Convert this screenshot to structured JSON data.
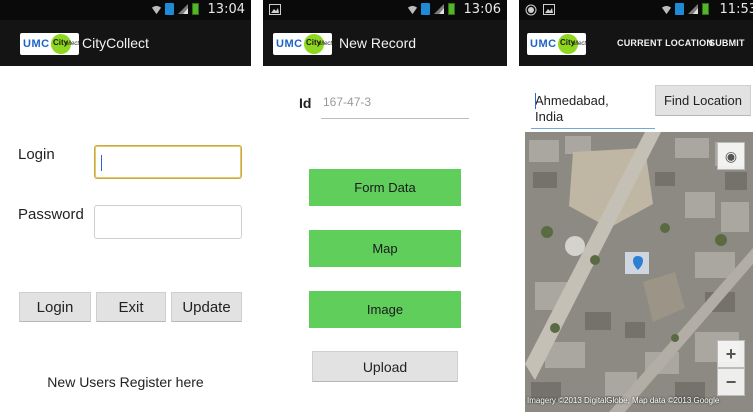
{
  "screens": {
    "login": {
      "status_time": "13:04",
      "logo_text": "UMC",
      "logo_circle_text": "City",
      "logo_subtext": "ollect",
      "app_title": "CityCollect",
      "login_label": "Login",
      "login_value": "",
      "password_label": "Password",
      "password_value": "",
      "buttons": [
        "Login",
        "Exit",
        "Update"
      ],
      "register_link": "New Users Register here"
    },
    "new_record": {
      "status_time": "13:06",
      "app_title": "New Record",
      "id_label": "Id",
      "id_value": "167-47-3",
      "buttons": [
        "Form Data",
        "Map",
        "Image"
      ],
      "upload_label": "Upload"
    },
    "map": {
      "status_time": "11:53",
      "actions": [
        "CURRENT LOCATION",
        "SUBMIT"
      ],
      "location_text": "Ahmedabad, India",
      "find_button": "Find Location",
      "zoom_in": "+",
      "zoom_out": "−",
      "attribution": "Imagery ©2013 DigitalGlobe, Map data ©2013 Google"
    }
  },
  "colors": {
    "status_bar": "#0a0a0a",
    "action_bar": "#141414",
    "green_button": "#5fce5b",
    "focus_border": "#c9a74b"
  },
  "icons": {
    "status": [
      "wifi-icon",
      "sim-icon",
      "signal-icon",
      "battery-icon"
    ],
    "map_controls": [
      "my-location-icon",
      "zoom-in-icon",
      "zoom-out-icon"
    ],
    "map_marker": "map-marker-icon"
  }
}
